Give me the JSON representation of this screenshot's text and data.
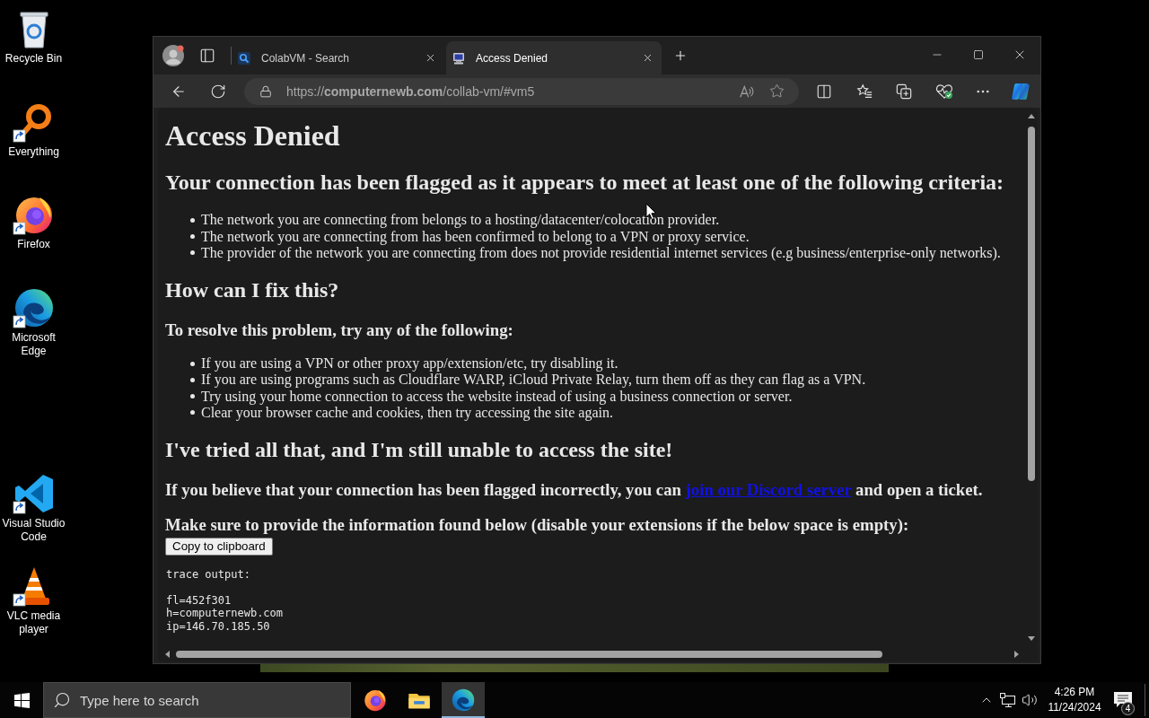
{
  "desktop": {
    "icons": [
      {
        "label": "Recycle Bin",
        "kind": "recycle-bin",
        "shortcut": false
      },
      {
        "label": "Everything",
        "kind": "everything",
        "shortcut": true
      },
      {
        "label": "Firefox",
        "kind": "firefox",
        "shortcut": true
      },
      {
        "label": "Microsoft Edge",
        "kind": "edge",
        "shortcut": true
      },
      {
        "label": "Visual Studio Code",
        "kind": "vscode",
        "shortcut": true
      },
      {
        "label": "VLC media player",
        "kind": "vlc",
        "shortcut": true
      }
    ]
  },
  "browser": {
    "tabs": [
      {
        "title": "ColabVM - Search",
        "kind": "search",
        "selected": false
      },
      {
        "title": "Access Denied",
        "kind": "computer",
        "selected": true
      }
    ],
    "address_bar": {
      "url": "https://**computernewb.com**/collab-vm/#vm5"
    },
    "page": {
      "blocks": [
        {
          "kind": "h1",
          "text": "Access Denied"
        },
        {
          "kind": "h2",
          "text": "Your connection has been flagged as it appears to meet at least one of the following criteria:"
        },
        {
          "kind": "list",
          "items": [
            "The network you are connecting from belongs to a hosting/datacenter/colocation provider.",
            "The network you are connecting from has been confirmed to belong to a VPN or proxy service.",
            "The provider of the network you are connecting from does not provide residential internet services (e.g business/enterprise-only networks)."
          ]
        },
        {
          "kind": "h2",
          "text": "How can I fix this?"
        },
        {
          "kind": "h3",
          "text": "To resolve this problem, try any of the following:"
        },
        {
          "kind": "list",
          "items": [
            "If you are using a VPN or other proxy app/extension/etc, try disabling it.",
            "If you are using programs such as Cloudflare WARP, iCloud Private Relay, turn them off as they can flag as a VPN.",
            "Try using your home connection to access the website instead of using a business connection or server.",
            "Clear your browser cache and cookies, then try accessing the site again."
          ]
        },
        {
          "kind": "h2",
          "text": "I've tried all that, and I'm still unable to access the site!"
        },
        {
          "kind": "h3",
          "text": "If you believe that your connection has been flagged incorrectly, you can ",
          "link": "join our Discord server",
          "text_after": " and open a ticket."
        },
        {
          "kind": "h3",
          "text": "Make sure to provide the information found below (disable your extensions if the below space is empty):"
        },
        {
          "kind": "button",
          "label": "Copy to clipboard"
        },
        {
          "kind": "trace",
          "heading": "trace output:",
          "lines": [
            "fl=452f301",
            "h=computernewb.com",
            "ip=146.70.185.50"
          ]
        }
      ]
    }
  },
  "taskbar": {
    "search": {
      "placeholder": "Type here to search"
    },
    "apps": [
      {
        "kind": "firefox",
        "open": false,
        "selected": false
      },
      {
        "kind": "file-explorer",
        "open": false,
        "selected": false
      },
      {
        "kind": "edge",
        "open": true,
        "selected": true
      }
    ],
    "clock": {
      "time": "4:26 PM",
      "date": "11/24/2024"
    },
    "notifications": {
      "count": "4"
    }
  }
}
